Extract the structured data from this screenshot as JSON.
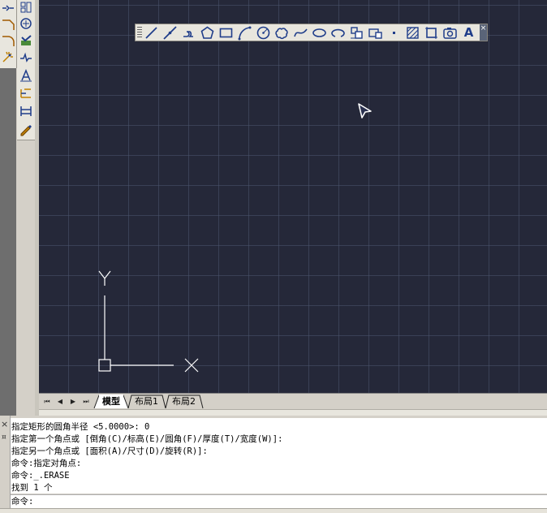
{
  "drawing_toolbar": {
    "tools": [
      {
        "name": "line-tool-icon"
      },
      {
        "name": "construction-line-tool-icon"
      },
      {
        "name": "polyline-tool-icon"
      },
      {
        "name": "polygon-tool-icon"
      },
      {
        "name": "rectangle-tool-icon"
      },
      {
        "name": "arc-tool-icon"
      },
      {
        "name": "circle-tool-icon"
      },
      {
        "name": "revision-cloud-tool-icon"
      },
      {
        "name": "spline-tool-icon"
      },
      {
        "name": "ellipse-tool-icon"
      },
      {
        "name": "ellipse-arc-tool-icon"
      },
      {
        "name": "insert-block-tool-icon"
      },
      {
        "name": "make-block-tool-icon"
      },
      {
        "name": "point-tool-icon"
      },
      {
        "name": "hatch-tool-icon"
      },
      {
        "name": "region-tool-icon"
      },
      {
        "name": "table-tool-icon"
      },
      {
        "name": "multiline-text-tool-icon"
      }
    ],
    "text_tool_glyph": "A",
    "close_glyph": "×"
  },
  "ucs_icon": {
    "y_label": "Y",
    "x_label": "X"
  },
  "layout_tabs": {
    "nav": [
      "⏮",
      "◀",
      "▶",
      "⏭"
    ],
    "tabs": [
      {
        "label": "模型",
        "active": true
      },
      {
        "label": "布局1",
        "active": false
      },
      {
        "label": "布局2",
        "active": false
      }
    ]
  },
  "command_window": {
    "history": [
      "指定矩形的圆角半径 <5.0000>: 0",
      "指定第一个角点或 [倒角(C)/标高(E)/圆角(F)/厚度(T)/宽度(W)]:",
      "指定另一个角点或 [面积(A)/尺寸(D)/旋转(R)]:",
      "命令:指定对角点:",
      "命令:_.ERASE",
      "找到 1 个"
    ],
    "prompt": "命令:",
    "close_glyph": "×",
    "pin_glyph": "¤"
  },
  "colors": {
    "canvas_bg": "#252839",
    "grid": "#4b556e",
    "toolbar_icon": "#1f3d8a",
    "ucs_stroke": "#ffffff"
  }
}
